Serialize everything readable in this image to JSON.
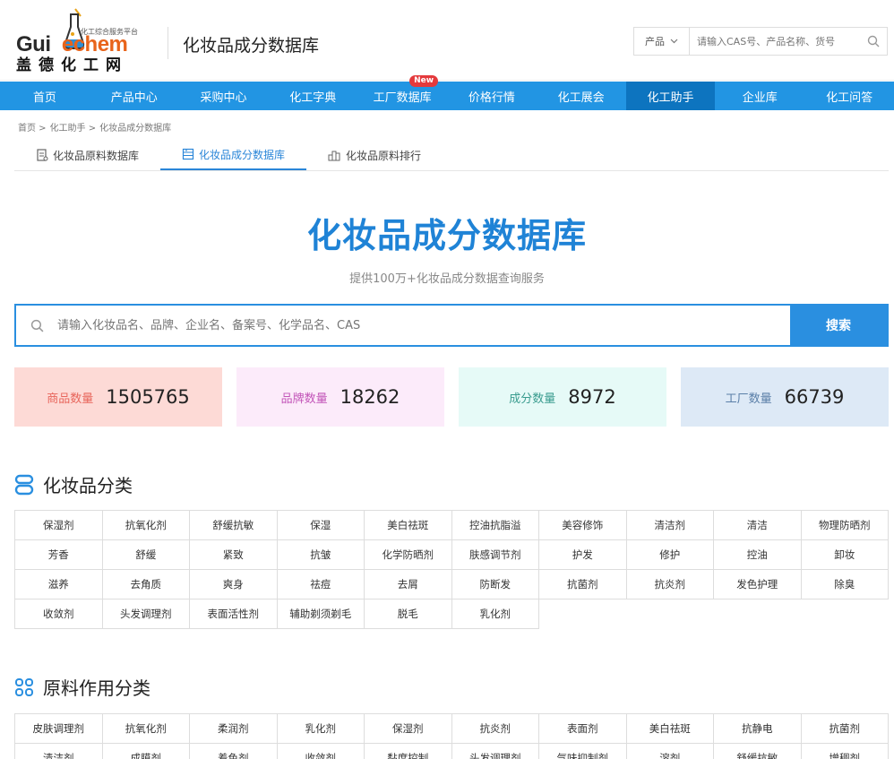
{
  "header": {
    "logo": {
      "en_prefix": "Gui",
      "en_suffix": "echem",
      "cn": "盖德化工网",
      "subtitle": "化工综合服务平台"
    },
    "site_title": "化妆品成分数据库",
    "search": {
      "select_label": "产品",
      "placeholder": "请输入CAS号、产品名称、货号"
    }
  },
  "nav": [
    {
      "label": "首页"
    },
    {
      "label": "产品中心"
    },
    {
      "label": "采购中心"
    },
    {
      "label": "化工字典"
    },
    {
      "label": "工厂数据库",
      "badge": "New"
    },
    {
      "label": "价格行情"
    },
    {
      "label": "化工展会"
    },
    {
      "label": "化工助手",
      "active": true
    },
    {
      "label": "企业库"
    },
    {
      "label": "化工问答"
    }
  ],
  "breadcrumb": [
    "首页 >",
    "化工助手 >",
    "化妆品成分数据库"
  ],
  "tabs": [
    {
      "label": "化妆品原料数据库",
      "icon": "document-icon"
    },
    {
      "label": "化妆品成分数据库",
      "icon": "database-icon",
      "active": true
    },
    {
      "label": "化妆品原料排行",
      "icon": "ranking-icon"
    }
  ],
  "hero": {
    "title": "化妆品成分数据库",
    "subtitle": "提供100万+化妆品成分数据查询服务"
  },
  "main_search": {
    "placeholder": "请输入化妆品名、品牌、企业名、备案号、化学品名、CAS",
    "button": "搜索"
  },
  "stats": [
    {
      "label": "商品数量",
      "value": "1505765",
      "bg": "#fddad6",
      "color": "#e8655b"
    },
    {
      "label": "品牌数量",
      "value": "18262",
      "bg": "#fcebfa",
      "color": "#c254b8"
    },
    {
      "label": "成分数量",
      "value": "8972",
      "bg": "#e6faf7",
      "color": "#3a9c8f"
    },
    {
      "label": "工厂数量",
      "value": "66739",
      "bg": "#dde9f6",
      "color": "#5a7fa8"
    }
  ],
  "section1": {
    "title": "化妆品分类",
    "items": [
      "保湿剂",
      "抗氧化剂",
      "舒缓抗敏",
      "保湿",
      "美白祛斑",
      "控油抗脂溢",
      "美容修饰",
      "清洁剂",
      "清洁",
      "物理防晒剂",
      "芳香",
      "舒缓",
      "紧致",
      "抗皱",
      "化学防晒剂",
      "肤感调节剂",
      "护发",
      "修护",
      "控油",
      "卸妆",
      "滋养",
      "去角质",
      "爽身",
      "祛痘",
      "去屑",
      "防断发",
      "抗菌剂",
      "抗炎剂",
      "发色护理",
      "除臭",
      "收敛剂",
      "头发调理剂",
      "表面活性剂",
      "辅助剃须剃毛",
      "脱毛",
      "乳化剂"
    ]
  },
  "section2": {
    "title": "原料作用分类",
    "items": [
      "皮肤调理剂",
      "抗氧化剂",
      "柔润剂",
      "乳化剂",
      "保湿剂",
      "抗炎剂",
      "表面剂",
      "美白祛斑",
      "抗静电",
      "抗菌剂",
      "清洁剂",
      "成膜剂",
      "着色剂",
      "收敛剂",
      "黏度控制",
      "头发调理剂",
      "气味抑制剂",
      "溶剂",
      "舒缓抗敏",
      "增稠剂"
    ]
  },
  "colors": {
    "primary": "#2295e3",
    "nav_active": "#0d74bf",
    "hero_title": "#1f83d6"
  }
}
